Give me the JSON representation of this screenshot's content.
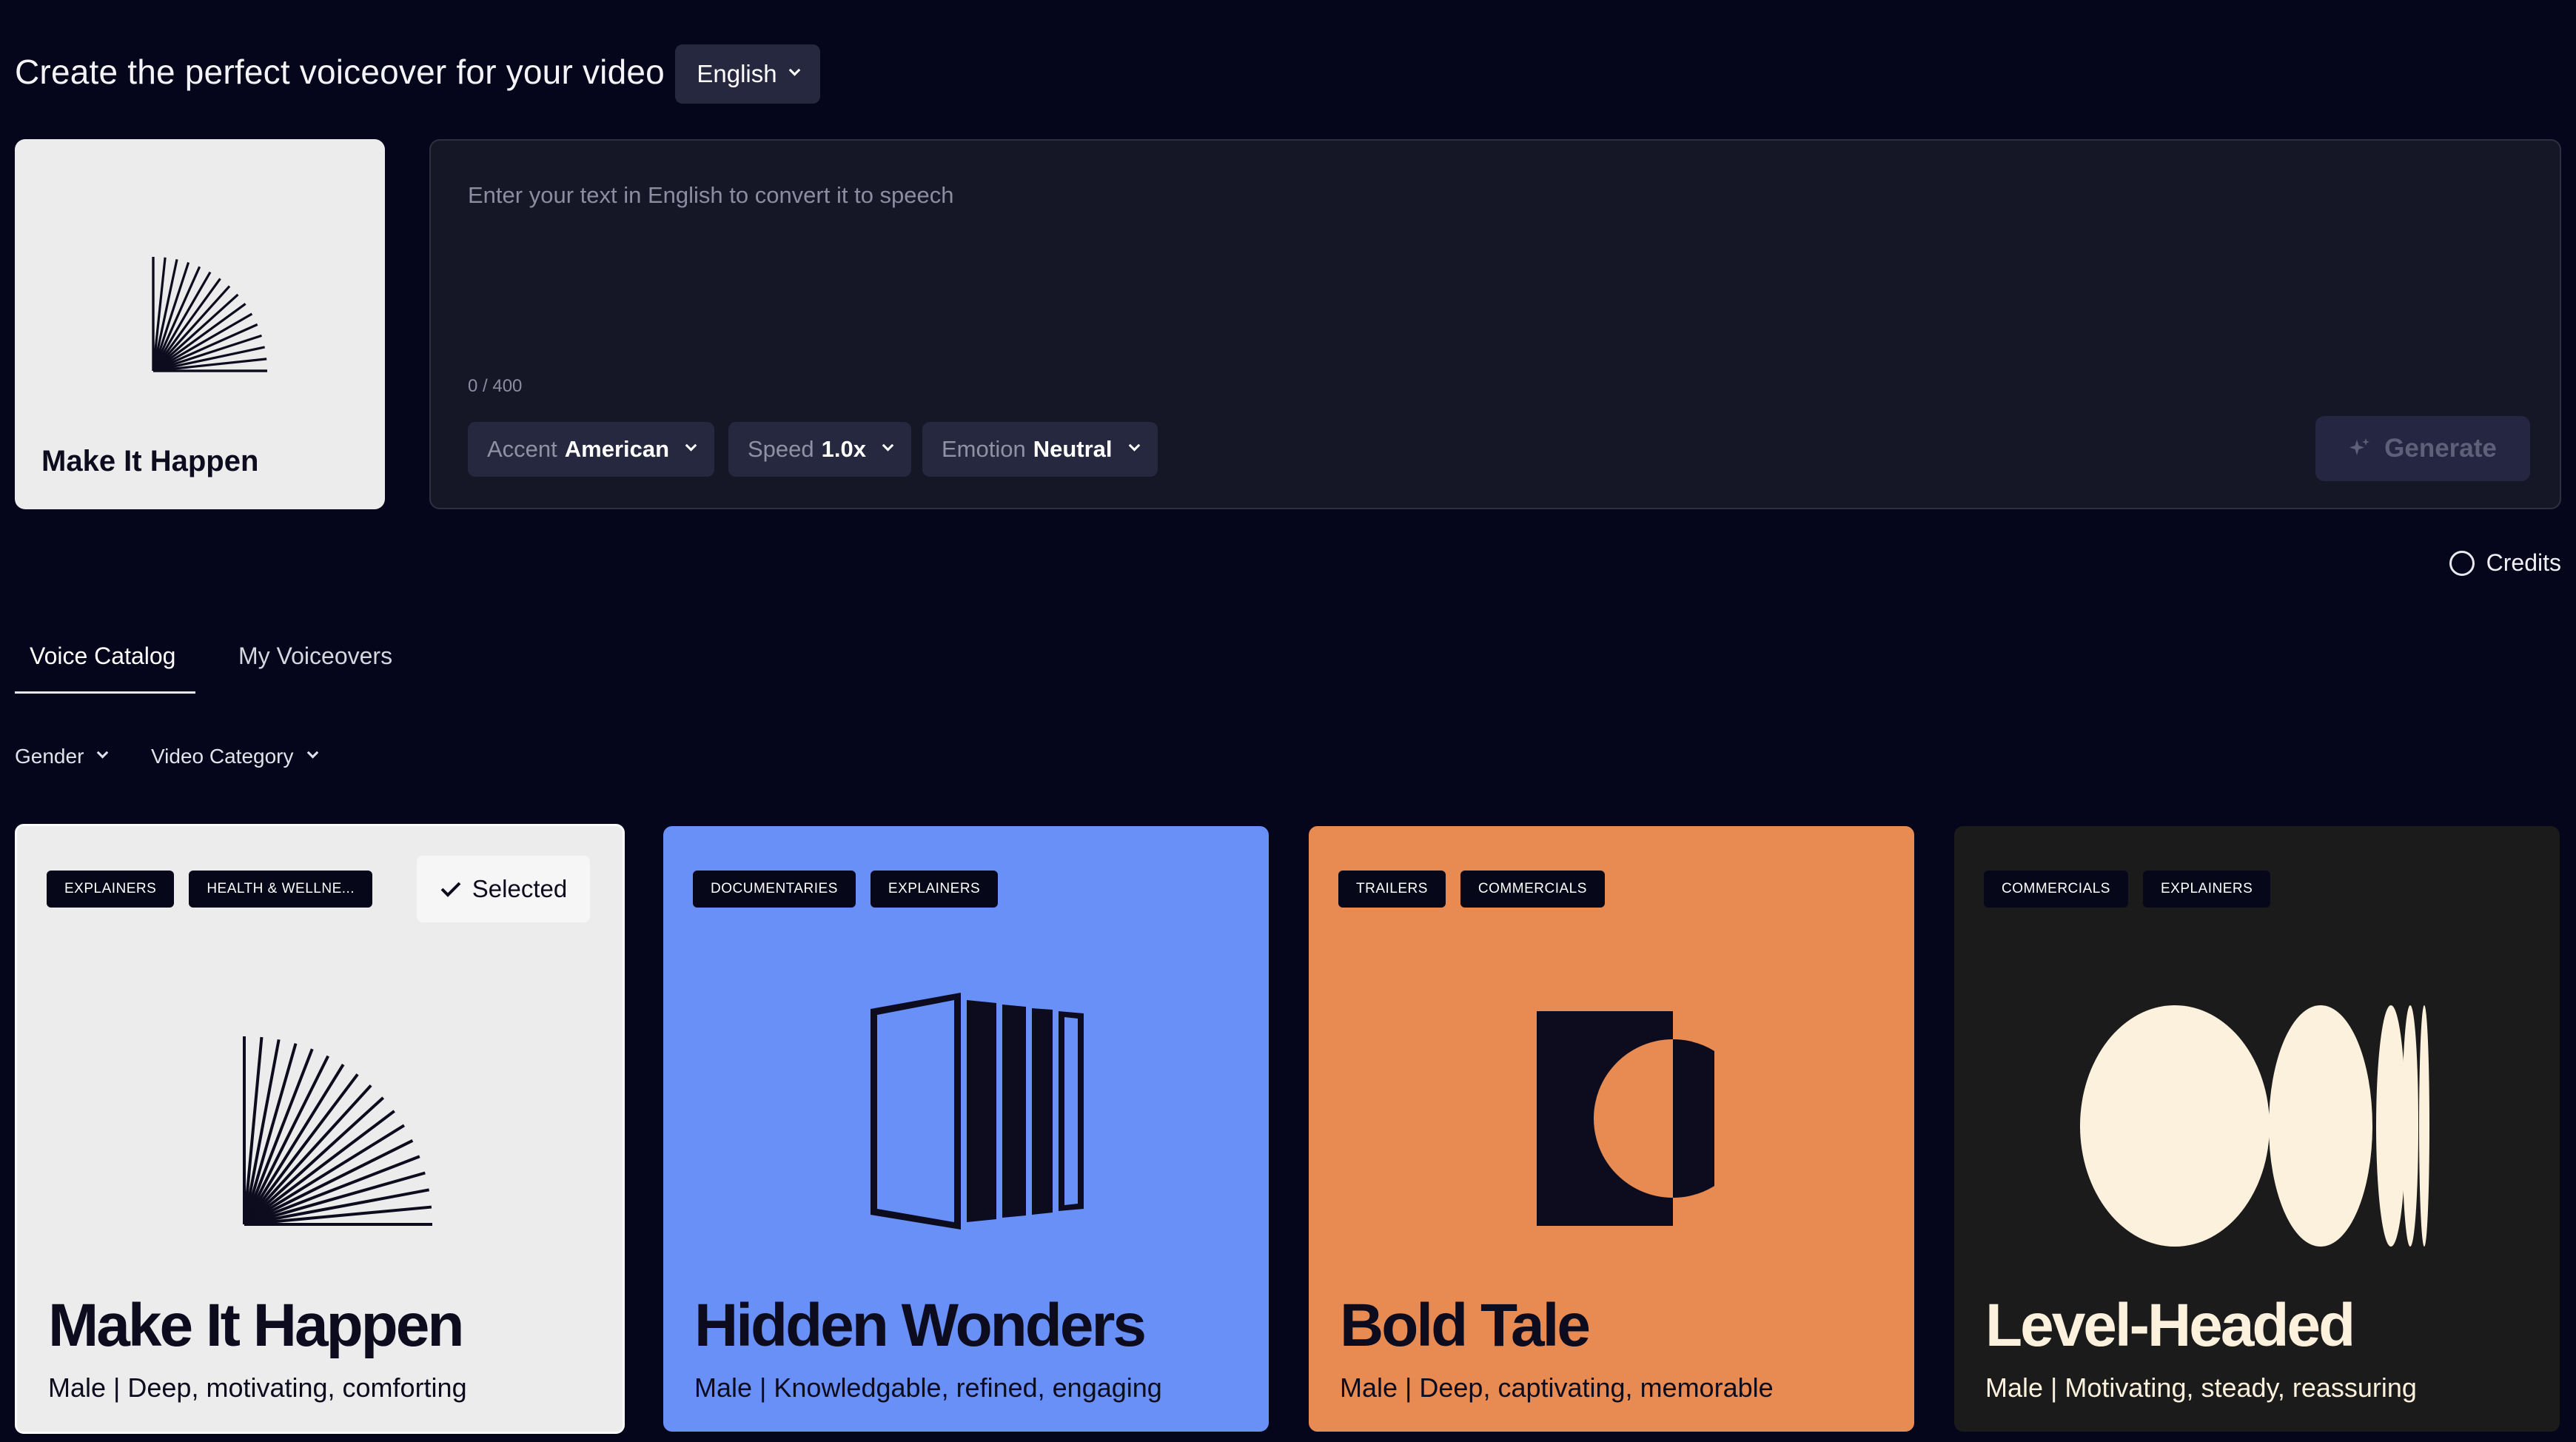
{
  "header": {
    "title": "Create the perfect voiceover for your video",
    "language": "English"
  },
  "preview": {
    "name": "Make It Happen"
  },
  "editor": {
    "placeholder": "Enter your text in English to convert it to speech",
    "counter": "0 / 400",
    "accent": {
      "label": "Accent",
      "value": "American"
    },
    "speed": {
      "label": "Speed",
      "value": "1.0x"
    },
    "emotion": {
      "label": "Emotion",
      "value": "Neutral"
    },
    "generate_label": "Generate"
  },
  "credits_label": "Credits",
  "tabs": [
    {
      "label": "Voice Catalog",
      "active": true
    },
    {
      "label": "My Voiceovers",
      "active": false
    }
  ],
  "filters": [
    {
      "label": "Gender"
    },
    {
      "label": "Video Category"
    }
  ],
  "colors": {
    "background": "#05051c",
    "card_gray": "#ececec",
    "card_blue": "#6890f7",
    "card_orange": "#e88b53",
    "card_dark": "#1b1b1b",
    "cream": "#fcf1dc"
  },
  "voices": [
    {
      "name": "Make It Happen",
      "description": "Male | Deep, motivating, comforting",
      "tags": [
        "EXPLAINERS",
        "HEALTH & WELLNE..."
      ],
      "selected": true,
      "selected_label": "Selected",
      "icon": "fan-lines-icon"
    },
    {
      "name": "Hidden Wonders",
      "description": "Male | Knowledgable, refined, engaging",
      "tags": [
        "DOCUMENTARIES",
        "EXPLAINERS"
      ],
      "selected": false,
      "icon": "stacked-panels-icon"
    },
    {
      "name": "Bold Tale",
      "description": "Male | Deep, captivating, memorable",
      "tags": [
        "TRAILERS",
        "COMMERCIALS"
      ],
      "selected": false,
      "icon": "half-circle-block-icon"
    },
    {
      "name": "Level-Headed",
      "description": "Male | Motivating, steady, reassuring",
      "tags": [
        "COMMERCIALS",
        "EXPLAINERS"
      ],
      "selected": false,
      "icon": "ellipse-sequence-icon"
    }
  ]
}
